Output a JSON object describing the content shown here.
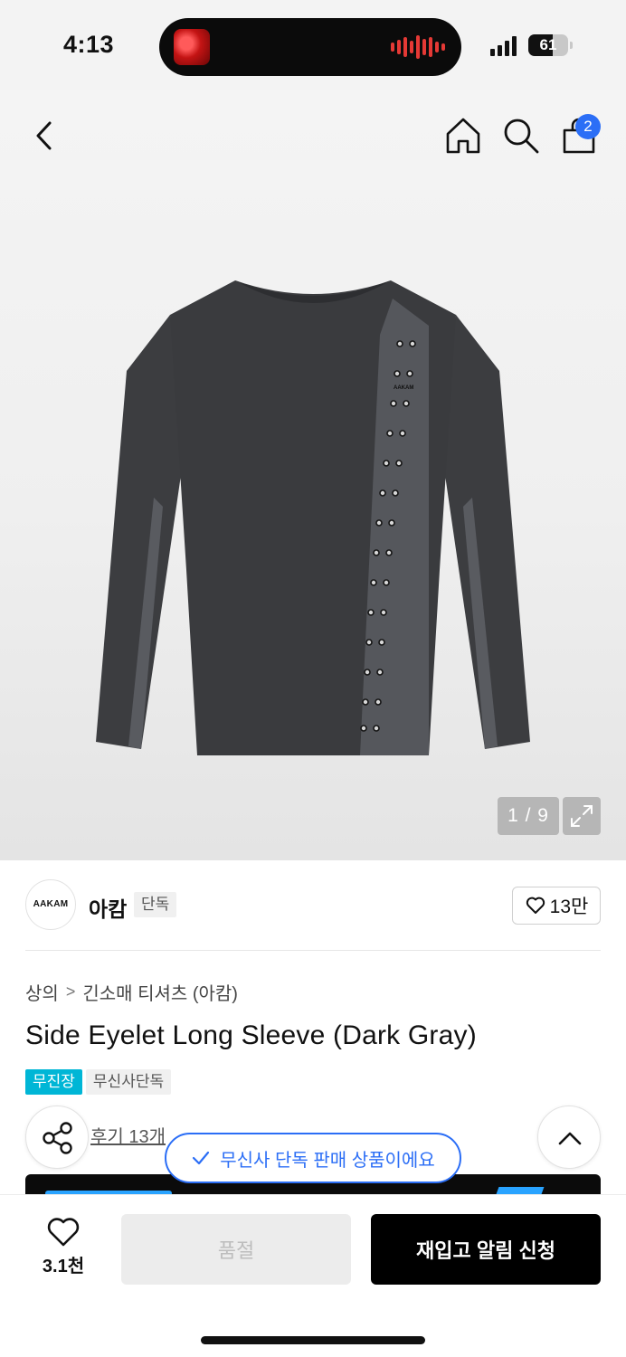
{
  "status_bar": {
    "time": "4:13",
    "battery": "61",
    "battery_level": 0.61
  },
  "nav": {
    "cart_badge": "2"
  },
  "gallery": {
    "counter": "1 / 9",
    "shirt_brand_print": "AAKAM"
  },
  "brand": {
    "logo_text": "AAKAM",
    "name": "아캄",
    "exclusive_label": "단독",
    "like_count": "13만"
  },
  "breadcrumb": {
    "category": "상의",
    "separator": ">",
    "subcategory": "긴소매 티셔츠 (아캄)"
  },
  "product": {
    "title": "Side Eyelet Long Sleeve (Dark Gray)",
    "tags": [
      "무진장",
      "무신사단독"
    ]
  },
  "reviews": {
    "label": "후기 13개"
  },
  "toast": {
    "message": "무신사 단독 판매 상품이에요"
  },
  "bottom_bar": {
    "wish_count": "3.1천",
    "soldout_label": "품절",
    "restock_label": "재입고 알림 신청"
  },
  "colors": {
    "accent_blue": "#2b6ef6",
    "tag_cyan": "#00b6d6",
    "black": "#000000"
  },
  "icons": [
    "back-icon",
    "home-icon",
    "search-icon",
    "cart-icon",
    "expand-icon",
    "heart-icon",
    "share-icon",
    "chevron-up-icon",
    "check-icon"
  ]
}
